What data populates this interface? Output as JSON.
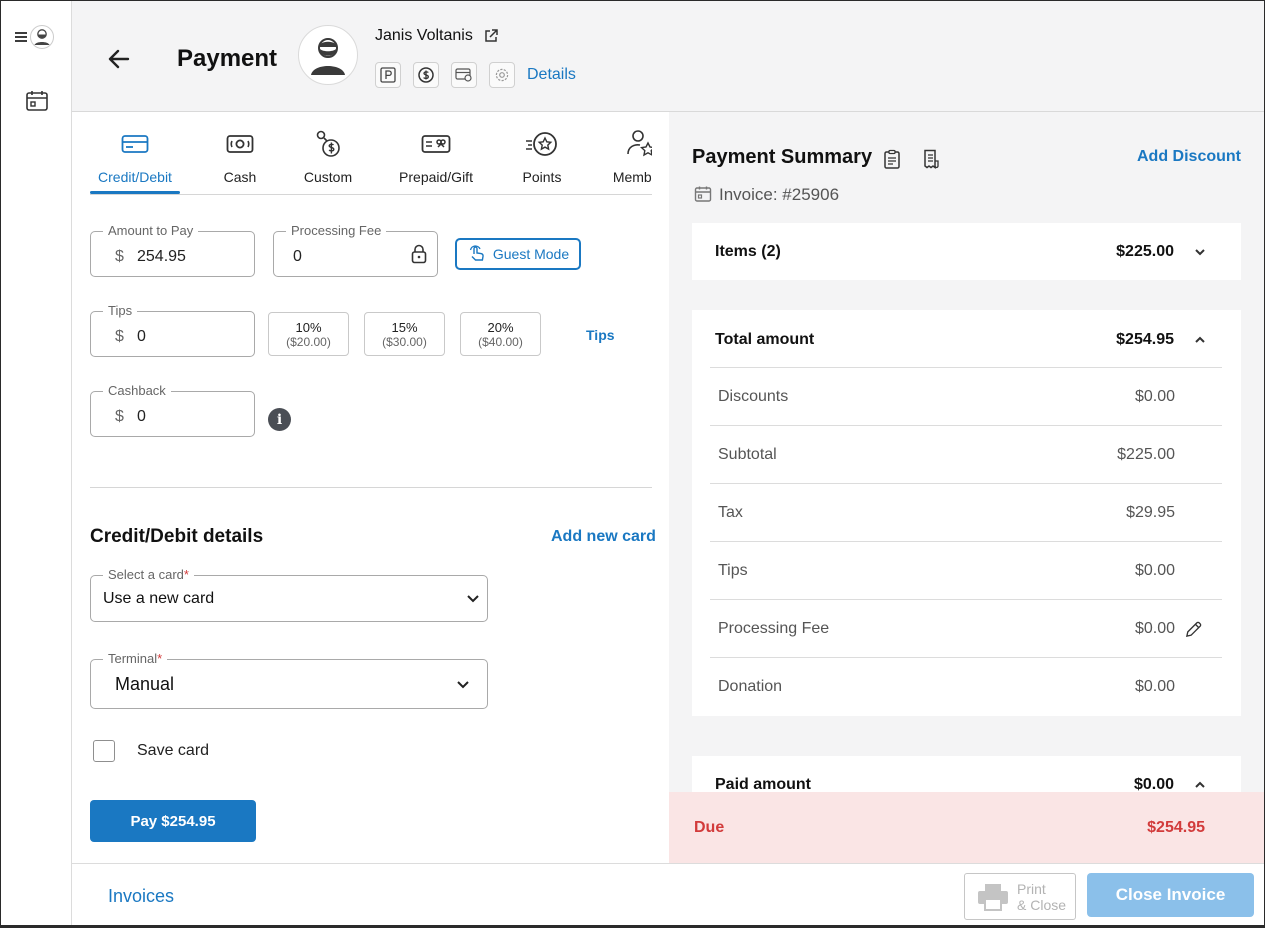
{
  "header": {
    "title": "Payment",
    "client_name": "Janis Voltanis",
    "details_label": "Details"
  },
  "tabs": [
    {
      "label": "Credit/Debit",
      "icon": "credit-card-icon",
      "active": true
    },
    {
      "label": "Cash",
      "icon": "cash-icon",
      "active": false
    },
    {
      "label": "Custom",
      "icon": "custom-payment-icon",
      "active": false
    },
    {
      "label": "Prepaid/Gift",
      "icon": "gift-card-icon",
      "active": false
    },
    {
      "label": "Points",
      "icon": "points-star-icon",
      "active": false
    },
    {
      "label": "Members",
      "icon": "member-star-icon",
      "active": false
    }
  ],
  "form": {
    "amount_label": "Amount to Pay",
    "currency": "$",
    "amount_value": "254.95",
    "fee_label": "Processing Fee",
    "fee_value": "0",
    "guest_mode_label": "Guest Mode",
    "tips_label": "Tips",
    "tips_value": "0",
    "tip_options": [
      {
        "pct": "10%",
        "amt": "($20.00)"
      },
      {
        "pct": "15%",
        "amt": "($30.00)"
      },
      {
        "pct": "20%",
        "amt": "($40.00)"
      }
    ],
    "tips_link": "Tips",
    "cashback_label": "Cashback",
    "cashback_value": "0",
    "info_glyph": "i"
  },
  "card_details": {
    "title": "Credit/Debit details",
    "add_new_card": "Add new card",
    "select_card_label": "Select a card",
    "select_card_value": "Use a new card",
    "terminal_label": "Terminal",
    "terminal_value": "Manual",
    "required_mark": "*",
    "save_card_label": "Save card",
    "save_card_checked": false,
    "pay_button": "Pay $254.95"
  },
  "summary": {
    "title": "Payment Summary",
    "add_discount": "Add Discount",
    "invoice": "Invoice: #25906",
    "items_label": "Items (2)",
    "items_amount": "$225.00",
    "total_label": "Total amount",
    "total_amount": "$254.95",
    "rows": [
      {
        "label": "Discounts",
        "value": "$0.00"
      },
      {
        "label": "Subtotal",
        "value": "$225.00"
      },
      {
        "label": "Tax",
        "value": "$29.95"
      },
      {
        "label": "Tips",
        "value": "$0.00"
      },
      {
        "label": "Processing Fee",
        "value": "$0.00"
      },
      {
        "label": "Donation",
        "value": "$0.00"
      }
    ],
    "paid_label": "Paid amount",
    "paid_amount": "$0.00",
    "due_label": "Due",
    "due_amount": "$254.95"
  },
  "footer": {
    "invoices_link": "Invoices",
    "print_line1": "Print",
    "print_line2": "& Close",
    "close_invoice": "Close Invoice"
  },
  "colors": {
    "accent": "#1a78c2",
    "due_red": "#d23b3b",
    "due_bg": "#fae5e5",
    "panel_bg": "#f4f4f5"
  }
}
